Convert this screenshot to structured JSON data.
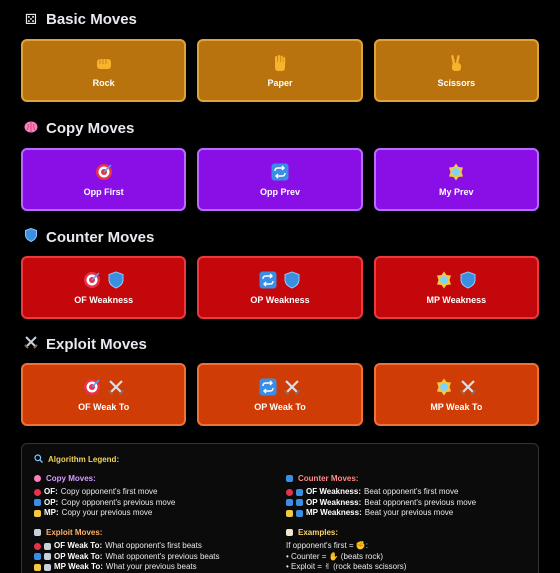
{
  "sections": {
    "basic": {
      "title": "Basic Moves",
      "icon": "dice-icon"
    },
    "copy": {
      "title": "Copy Moves",
      "icon": "brain-icon"
    },
    "counter": {
      "title": "Counter Moves",
      "icon": "shield-icon"
    },
    "exploit": {
      "title": "Exploit Moves",
      "icon": "crossed-swords-icon"
    }
  },
  "basic_buttons": [
    {
      "label": "Rock",
      "icon": "fist-icon"
    },
    {
      "label": "Paper",
      "icon": "raised-hand-icon"
    },
    {
      "label": "Scissors",
      "icon": "victory-hand-icon"
    }
  ],
  "copy_buttons": [
    {
      "label": "Opp First",
      "icon": "target-icon"
    },
    {
      "label": "Opp Prev",
      "icon": "repeat-icon"
    },
    {
      "label": "My Prev",
      "icon": "sparkle-shape-icon"
    }
  ],
  "counter_buttons": [
    {
      "label": "OF Weakness",
      "icons": [
        "target-icon",
        "shield-icon"
      ]
    },
    {
      "label": "OP Weakness",
      "icons": [
        "repeat-icon",
        "shield-icon"
      ]
    },
    {
      "label": "MP Weakness",
      "icons": [
        "sparkle-shape-icon",
        "shield-icon"
      ]
    }
  ],
  "exploit_buttons": [
    {
      "label": "OF Weak To",
      "icons": [
        "target-icon",
        "crossed-swords-icon"
      ]
    },
    {
      "label": "OP Weak To",
      "icons": [
        "repeat-icon",
        "crossed-swords-icon"
      ]
    },
    {
      "label": "MP Weak To",
      "icons": [
        "sparkle-shape-icon",
        "crossed-swords-icon"
      ]
    }
  ],
  "legend": {
    "title": "Algorithm Legend:",
    "copy": {
      "title": "Copy Moves:",
      "lines": [
        {
          "key": "OF:",
          "text": "Copy opponent's first move"
        },
        {
          "key": "OP:",
          "text": "Copy opponent's previous move"
        },
        {
          "key": "MP:",
          "text": "Copy your previous move"
        }
      ]
    },
    "counter": {
      "title": "Counter Moves:",
      "lines": [
        {
          "key": "OF Weakness:",
          "text": "Beat opponent's first move"
        },
        {
          "key": "OP Weakness:",
          "text": "Beat opponent's previous move"
        },
        {
          "key": "MP Weakness:",
          "text": "Beat your previous move"
        }
      ]
    },
    "exploit": {
      "title": "Exploit Moves:",
      "lines": [
        {
          "key": "OF Weak To:",
          "text": "What opponent's first beats"
        },
        {
          "key": "OP Weak To:",
          "text": "What opponent's previous beats"
        },
        {
          "key": "MP Weak To:",
          "text": "What your previous beats"
        }
      ]
    },
    "examples": {
      "title": "Examples:",
      "lines": [
        "If opponent's first = ✊:",
        "• Counter = ✋ (beats rock)",
        "• Exploit = ✌ (rock beats scissors)"
      ]
    }
  },
  "colors": {
    "basic": "#b8730f",
    "copy": "#8a0fe6",
    "counter": "#c4070a",
    "exploit": "#d03c06",
    "legend_title": "#f2d35b",
    "legend_copy": "#d69cff",
    "legend_counter": "#ff8a8a",
    "legend_exploit": "#ffb067",
    "legend_examples": "#ffd36b"
  }
}
